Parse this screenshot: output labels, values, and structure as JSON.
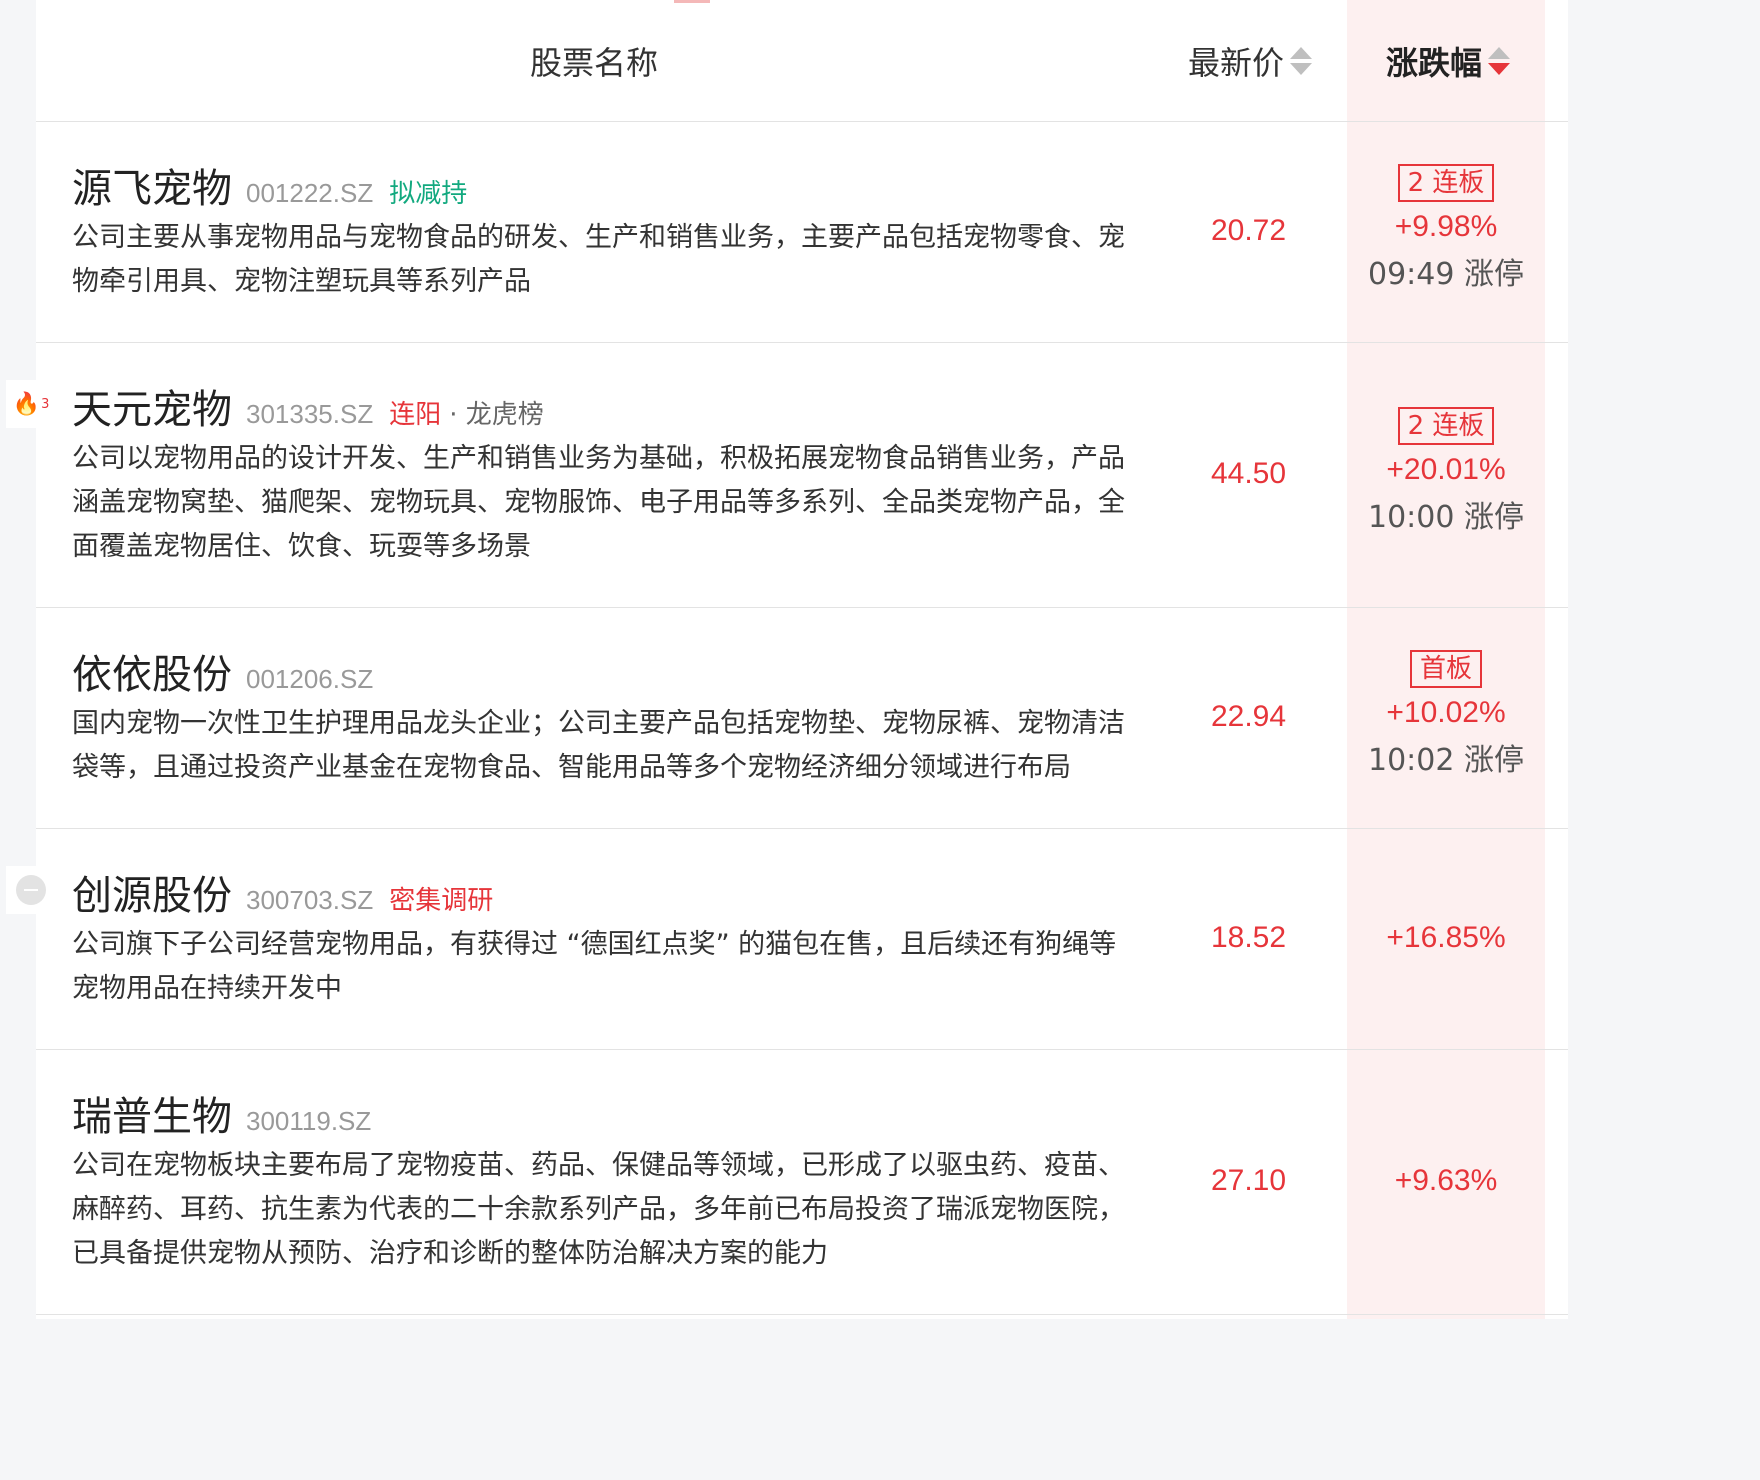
{
  "header": {
    "name_label": "股票名称",
    "price_label": "最新价",
    "change_label": "涨跌幅"
  },
  "rows": [
    {
      "name": "源飞宠物",
      "code": "001222.SZ",
      "tags": [
        {
          "text": "拟减持",
          "color": "green"
        }
      ],
      "desc": "公司主要从事宠物用品与宠物食品的研发、生产和销售业务，主要产品包括宠物零食、宠物牵引用具、宠物注塑玩具等系列产品",
      "price": "20.72",
      "board": "2 连板",
      "change": "+9.98%",
      "limit_time": "09:49 涨停"
    },
    {
      "name": "天元宠物",
      "code": "301335.SZ",
      "side_badge": {
        "icon": "fire-icon",
        "count": "3"
      },
      "tags": [
        {
          "text": "连阳",
          "color": "red"
        },
        {
          "text": "· 龙虎榜",
          "color": "gray"
        }
      ],
      "desc": "公司以宠物用品的设计开发、生产和销售业务为基础，积极拓展宠物食品销售业务，产品涵盖宠物窝垫、猫爬架、宠物玩具、宠物服饰、电子用品等多系列、全品类宠物产品，全面覆盖宠物居住、饮食、玩耍等多场景",
      "price": "44.50",
      "board": "2 连板",
      "change": "+20.01%",
      "limit_time": "10:00 涨停"
    },
    {
      "name": "依依股份",
      "code": "001206.SZ",
      "tags": [],
      "desc": "国内宠物一次性卫生护理用品龙头企业；公司主要产品包括宠物垫、宠物尿裤、宠物清洁袋等，且通过投资产业基金在宠物食品、智能用品等多个宠物经济细分领域进行布局",
      "price": "22.94",
      "board": "首板",
      "change": "+10.02%",
      "limit_time": "10:02 涨停"
    },
    {
      "name": "创源股份",
      "code": "300703.SZ",
      "side_badge": {
        "icon": "minus-circle-icon"
      },
      "tags": [
        {
          "text": "密集调研",
          "color": "red"
        }
      ],
      "desc": "公司旗下子公司经营宠物用品，有获得过 “德国红点奖” 的猫包在售，且后续还有狗绳等宠物用品在持续开发中",
      "price": "18.52",
      "change": "+16.85%"
    },
    {
      "name": "瑞普生物",
      "code": "300119.SZ",
      "tags": [],
      "desc": "公司在宠物板块主要布局了宠物疫苗、药品、保健品等领域，已形成了以驱虫药、疫苗、麻醉药、耳药、抗生素为代表的二十余款系列产品，多年前已布局投资了瑞派宠物医院，已具备提供宠物从预防、治疗和诊断的整体防治解决方案的能力",
      "price": "27.10",
      "change": "+9.63%"
    }
  ]
}
